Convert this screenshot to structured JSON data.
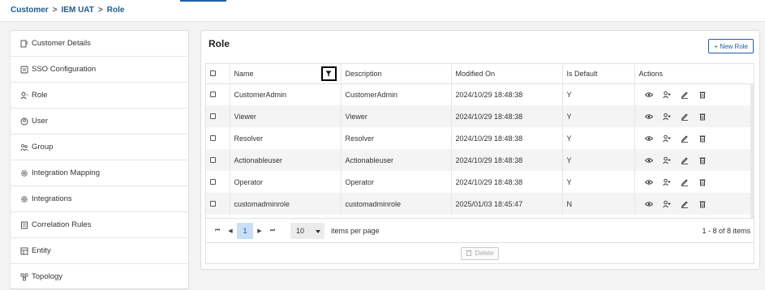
{
  "breadcrumb": {
    "items": [
      "Customer",
      "IEM UAT",
      "Role"
    ],
    "separator": ">"
  },
  "sidebar": {
    "items": [
      {
        "label": "Customer Details",
        "icon": "id-card-icon"
      },
      {
        "label": "SSO Configuration",
        "icon": "sso-icon"
      },
      {
        "label": "Role",
        "icon": "user-role-icon"
      },
      {
        "label": "User",
        "icon": "user-icon"
      },
      {
        "label": "Group",
        "icon": "group-icon"
      },
      {
        "label": "Integration Mapping",
        "icon": "gear-icon"
      },
      {
        "label": "Integrations",
        "icon": "gear-icon"
      },
      {
        "label": "Correlation Rules",
        "icon": "rules-icon"
      },
      {
        "label": "Entity",
        "icon": "entity-icon"
      },
      {
        "label": "Topology",
        "icon": "topology-icon"
      }
    ]
  },
  "panel": {
    "title": "Role",
    "new_button": "+ New Role",
    "columns": [
      "Name",
      "Description",
      "Modified On",
      "Is Default",
      "Actions"
    ],
    "rows": [
      {
        "name": "CustomerAdmin",
        "description": "CustomerAdmin",
        "modified": "2024/10/29 18:48:38",
        "is_default": "Y"
      },
      {
        "name": "Viewer",
        "description": "Viewer",
        "modified": "2024/10/29 18:48:38",
        "is_default": "Y"
      },
      {
        "name": "Resolver",
        "description": "Resolver",
        "modified": "2024/10/29 18:48:38",
        "is_default": "Y"
      },
      {
        "name": "Actionableuser",
        "description": "Actionableuser",
        "modified": "2024/10/29 18:48:38",
        "is_default": "Y"
      },
      {
        "name": "Operator",
        "description": "Operator",
        "modified": "2024/10/29 18:48:38",
        "is_default": "Y"
      },
      {
        "name": "customadminrole",
        "description": "customadminrole",
        "modified": "2025/01/03 18:45:47",
        "is_default": "N"
      }
    ],
    "pager": {
      "first": "⏮",
      "prev": "◀",
      "next": "▶",
      "last": "⏭",
      "page": "1",
      "per_page": "10",
      "per_page_label": "items per page",
      "count": "1 - 8 of 8 items"
    },
    "delete_button": "Delete"
  },
  "colors": {
    "accent": "#1f5fa8",
    "breadcrumb": "#1d5b8f",
    "page_highlight": "#c9dff5"
  }
}
